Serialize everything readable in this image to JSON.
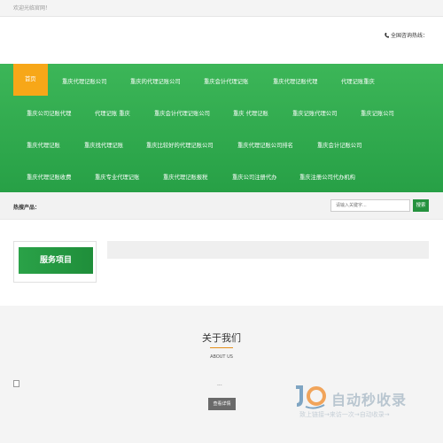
{
  "topbar": {
    "welcome": "欢迎光临官网！"
  },
  "header": {
    "hotline_label": "全国咨询热线："
  },
  "nav": {
    "items": [
      "首页",
      "重庆代理记账公司",
      "重庆的代理记账公司",
      "重庆会计代理记账",
      "重庆代理记账代理",
      "代理记账重庆",
      "重庆公司记账代理",
      "代理记账 重庆",
      "重庆会计代理记账公司",
      "重庆 代理记账",
      "重庆记账代理公司",
      "重庆记账公司",
      "重庆代理记账",
      "重庆找代理记账",
      "重庆比较好的代理记账公司",
      "重庆代理记账公司排名",
      "重庆会计记账公司",
      "重庆代理记账收费",
      "重庆专业代理记账",
      "重庆代理记账报税",
      "重庆公司注册代办",
      "重庆注册公司代办机构"
    ]
  },
  "search": {
    "hot_label": "热搜产品：",
    "placeholder": "请输入关键字...",
    "button": "搜索"
  },
  "service": {
    "title": "服务项目"
  },
  "about": {
    "title": "关于我们",
    "subtitle": "ABOUT US",
    "ellipsis": "...",
    "more_button": "查看详情"
  },
  "watermark": {
    "title": "自动秒收录",
    "subtitle": "致上链接→来访一次→自动收录→"
  },
  "colors": {
    "green": "#2aa44b",
    "orange": "#f7a718",
    "dark_green": "#25923e"
  }
}
